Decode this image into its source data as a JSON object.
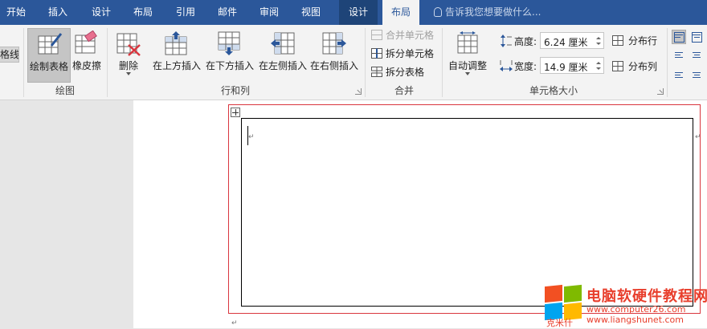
{
  "tabs": [
    "开始",
    "插入",
    "设计",
    "布局",
    "引用",
    "邮件",
    "审阅",
    "视图",
    "设计",
    "布局"
  ],
  "tell_me": "告诉我您想要做什么...",
  "ribbon": {
    "cut_label": "格线",
    "draw": {
      "draw_table": "绘制表格",
      "eraser": "橡皮擦",
      "group": "绘图"
    },
    "rows_cols": {
      "delete": "删除",
      "insert_above": "在上方插入",
      "insert_below": "在下方插入",
      "insert_left": "在左侧插入",
      "insert_right": "在右侧插入",
      "group": "行和列"
    },
    "merge": {
      "merge_cells": "合并单元格",
      "split_cells": "拆分单元格",
      "split_table": "拆分表格",
      "group": "合并"
    },
    "cell_size": {
      "autofit": "自动调整",
      "height_label": "高度:",
      "height_value": "6.24 厘米",
      "width_label": "宽度:",
      "width_value": "14.9 厘米",
      "distribute_rows": "分布行",
      "distribute_cols": "分布列",
      "group": "单元格大小"
    }
  },
  "document": {
    "paragraph_mark": "↵"
  },
  "watermark": {
    "title": "电脑软硬件教程网",
    "url": "www.computer26.com",
    "url2": "www.liangshunet.com",
    "small": "克米什"
  },
  "colors": {
    "tab_bar": "#2b579a",
    "contextual_tab": "#1e4478",
    "ribbon_bg": "#f3f3f3",
    "table_selection": "#d9363e",
    "watermark": "#e83e2c"
  }
}
